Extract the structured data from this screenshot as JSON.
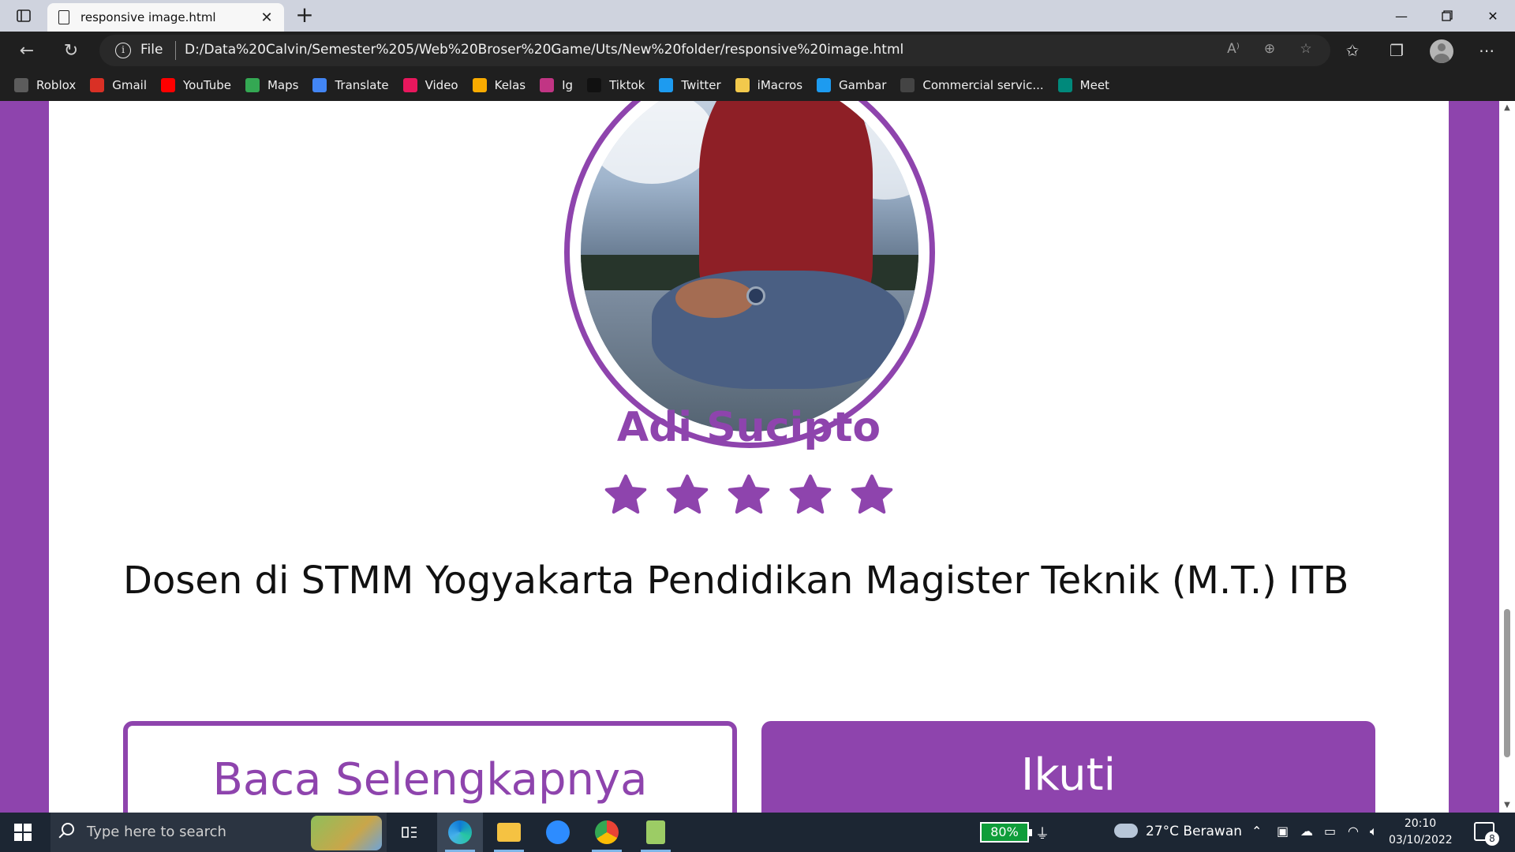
{
  "browser": {
    "tab_title": "responsive image.html",
    "scheme_label": "File",
    "url": "D:/Data%20Calvin/Semester%205/Web%20Broser%20Game/Uts/New%20folder/responsive%20image.html",
    "new_tab_symbol": "+"
  },
  "bookmarks": [
    {
      "label": "Roblox",
      "icon": "roblox-icon",
      "color": "#5c5c5c"
    },
    {
      "label": "Gmail",
      "icon": "gmail-icon",
      "color": "#d93025"
    },
    {
      "label": "YouTube",
      "icon": "youtube-icon",
      "color": "#ff0000"
    },
    {
      "label": "Maps",
      "icon": "maps-icon",
      "color": "#34a853"
    },
    {
      "label": "Translate",
      "icon": "translate-icon",
      "color": "#4285f4"
    },
    {
      "label": "Video",
      "icon": "video-icon",
      "color": "#e8175d"
    },
    {
      "label": "Kelas",
      "icon": "classroom-icon",
      "color": "#f9ab00"
    },
    {
      "label": "Ig",
      "icon": "instagram-icon",
      "color": "#c13584"
    },
    {
      "label": "Tiktok",
      "icon": "tiktok-icon",
      "color": "#111111"
    },
    {
      "label": "Twitter",
      "icon": "twitter-icon",
      "color": "#1d9bf0"
    },
    {
      "label": "iMacros",
      "icon": "folder-icon",
      "color": "#f2c94c"
    },
    {
      "label": "Gambar",
      "icon": "twitter-icon",
      "color": "#1d9bf0"
    },
    {
      "label": "Commercial servic...",
      "icon": "globe-icon",
      "color": "#444444"
    },
    {
      "label": "Meet",
      "icon": "meet-icon",
      "color": "#00897b"
    }
  ],
  "profile": {
    "name": "Adi Sucipto",
    "rating_stars": 5,
    "description": "Dosen di STMM Yogyakarta Pendidikan Magister Teknik (M.T.) ITB",
    "read_more_label": "Baca Selengkapnya",
    "follow_label": "Ikuti",
    "accent_color": "#8e44ad"
  },
  "taskbar": {
    "search_placeholder": "Type here to search",
    "battery": "80%",
    "weather": "27°C  Berawan",
    "time": "20:10",
    "date": "03/10/2022",
    "notification_count": "8"
  }
}
